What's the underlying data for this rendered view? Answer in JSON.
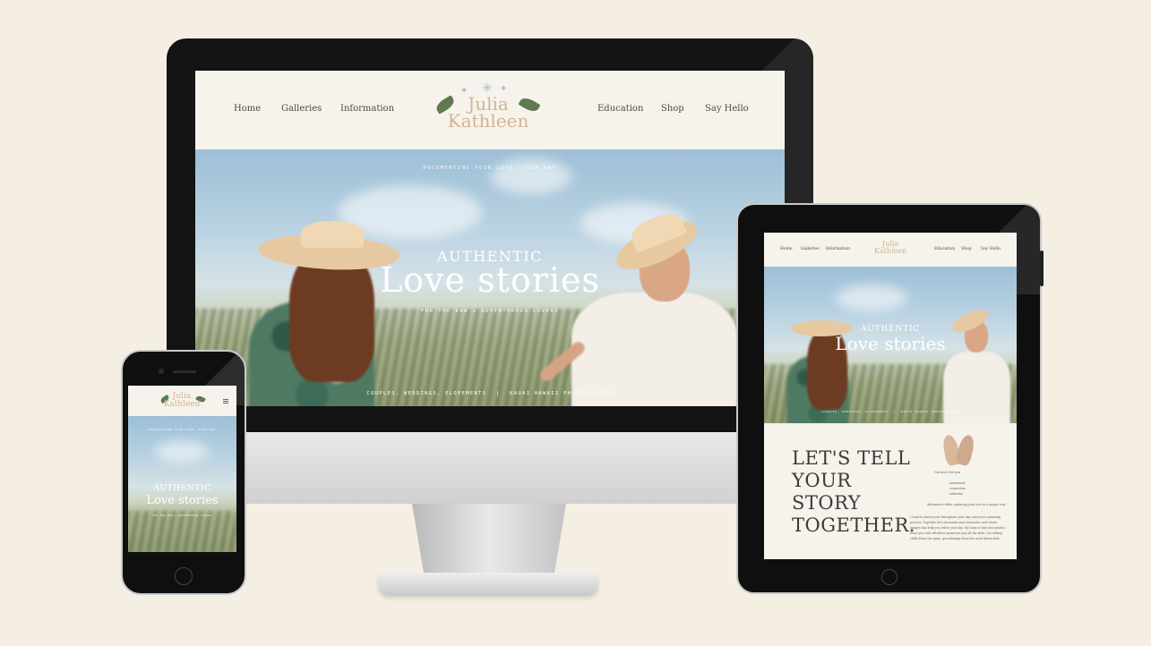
{
  "site": {
    "logo_line1": "Julia",
    "logo_line2": "Kathleen",
    "nav_left": [
      "Home",
      "Galleries",
      "Information"
    ],
    "nav_right": [
      "Education",
      "Shop",
      "Say Hello"
    ],
    "hero_tagline": "DOCUMENTING YOUR LOVE, YOUR WAY",
    "hero_small": "AUTHENTIC",
    "hero_big": "Love stories",
    "hero_sub": "FOR THE RAW + ADVENTUROUS LOVERS",
    "hero_footer_left": "COUPLES, WEDDINGS, ELOPEMENTS",
    "hero_footer_sep": "|",
    "hero_footer_right": "KAUAI HAWAII PHOTOGRAPHER"
  },
  "tablet": {
    "story_heading": [
      "LET'S TELL",
      "YOUR",
      "STORY",
      "TOGETHER."
    ],
    "hello_line": "I'm here for you",
    "mini_list": [
      "intentional",
      "connection",
      "authentic"
    ],
    "body_short": "Adventures while capturing your love in a unique way.",
    "body_long": [
      "I want to invest your throughout your day and you're planning",
      "process. Together let's document your memories and create",
      "images that help you relive your day. My hope is that your photos",
      "leave you with effortless memories and all the feels. I'm talking",
      "chills down the spine, goosebumps down the arms kinda feels."
    ]
  },
  "colors": {
    "background": "#f5efe3",
    "logo_tan": "#d4b48f",
    "leaf_green": "#5f7a4e",
    "device_black": "#111111"
  }
}
